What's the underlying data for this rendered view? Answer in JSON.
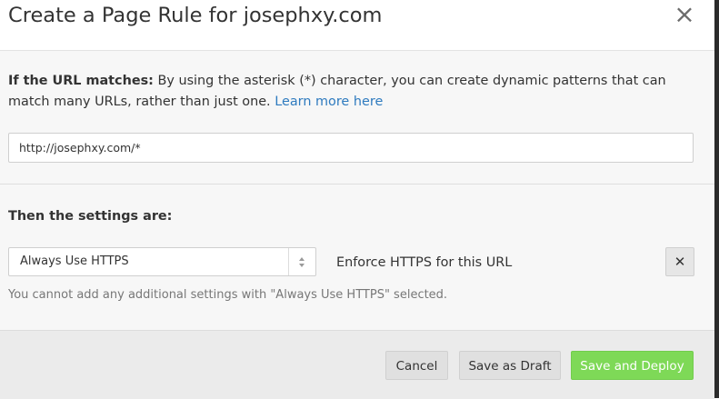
{
  "dialog": {
    "title": "Create a Page Rule for josephxy.com",
    "close_icon": "close-icon"
  },
  "url_section": {
    "label": "If the URL matches:",
    "description": " By using the asterisk (*) character, you can create dynamic patterns that can match many URLs, rather than just one. ",
    "learn_more": "Learn more here",
    "url_value": "http://josephxy.com/*"
  },
  "settings_section": {
    "label": "Then the settings are:",
    "setting_selected": "Always Use HTTPS",
    "setting_description": "Enforce HTTPS for this URL",
    "remove_icon": "close-icon",
    "remove_symbol": "✕",
    "note": "You cannot add any additional settings with \"Always Use HTTPS\" selected."
  },
  "footer": {
    "cancel_label": "Cancel",
    "draft_label": "Save as Draft",
    "deploy_label": "Save and Deploy"
  },
  "colors": {
    "link": "#2f7bbf",
    "deploy_button": "#7ed957",
    "section_background": "#f7f7f7",
    "footer_background": "#ebebeb"
  }
}
